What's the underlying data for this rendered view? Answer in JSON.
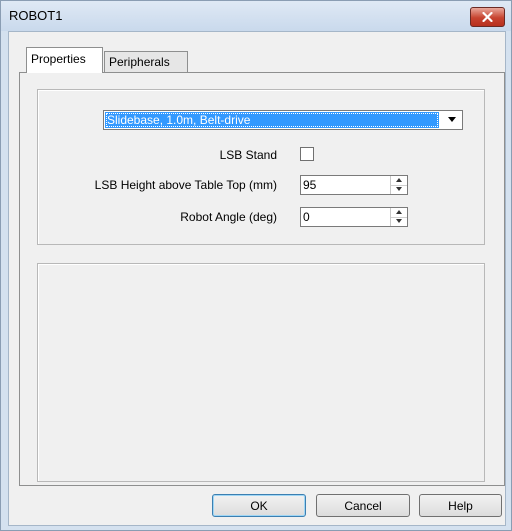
{
  "window": {
    "title": "ROBOT1"
  },
  "tabs": [
    {
      "label": "Properties",
      "active": true
    },
    {
      "label": "Peripherals",
      "active": false
    }
  ],
  "properties": {
    "base_type": {
      "selected": "Slidebase, 1.0m, Belt-drive"
    },
    "lsb_stand": {
      "label": "LSB Stand",
      "checked": false
    },
    "lsb_height": {
      "label": "LSB Height above Table Top (mm)",
      "value": "95"
    },
    "robot_angle": {
      "label": "Robot Angle (deg)",
      "value": "0"
    }
  },
  "buttons": {
    "ok": "OK",
    "cancel": "Cancel",
    "help": "Help"
  },
  "colors": {
    "selection": "#3399ff",
    "close_button": "#c7432f",
    "frame": "#d4e1ef"
  },
  "icons": {
    "close": "close-icon",
    "dropdown": "chevron-down-icon",
    "spin_up": "spin-up-icon",
    "spin_down": "spin-down-icon"
  }
}
